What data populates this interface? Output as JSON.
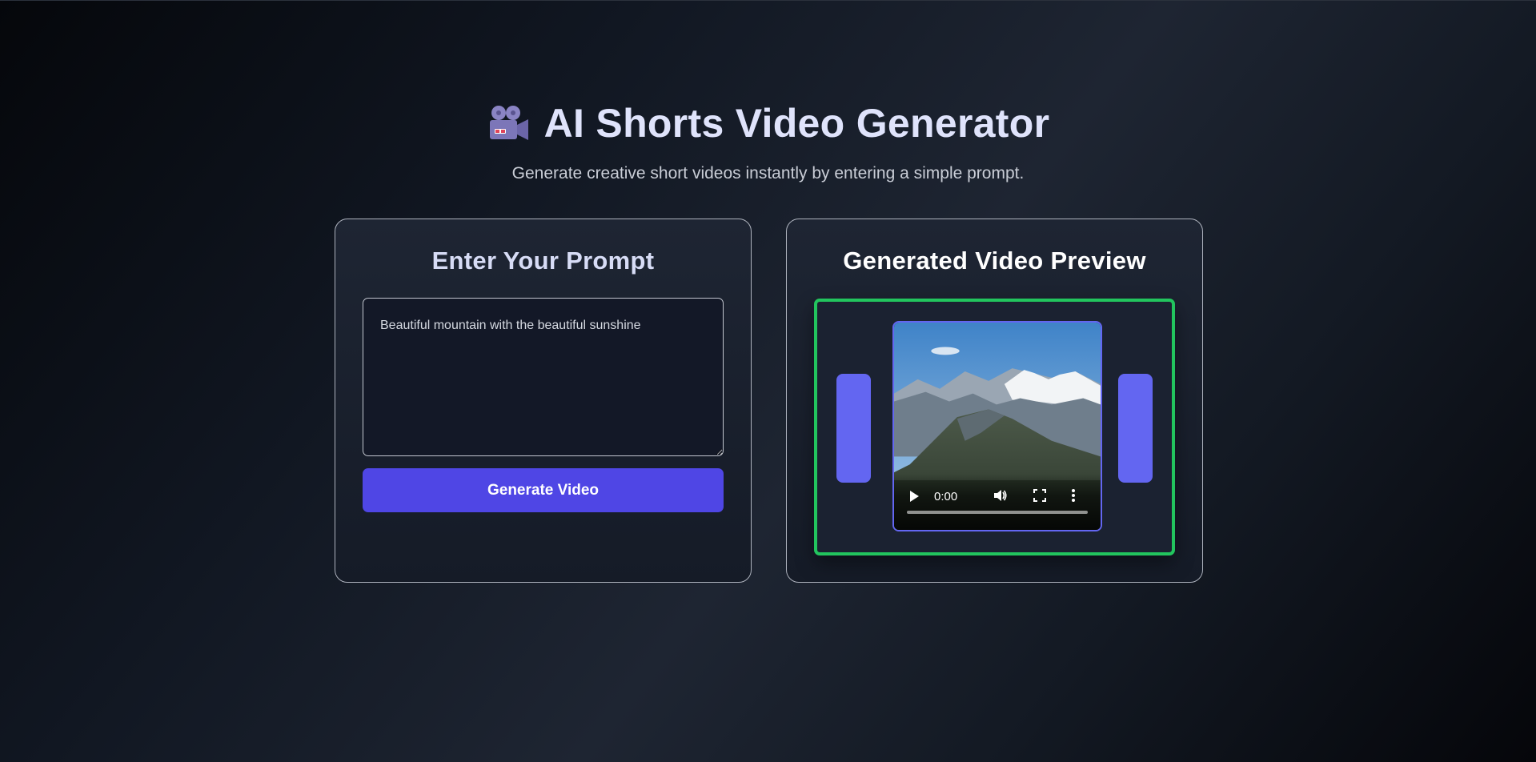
{
  "header": {
    "icon": "movie-camera-icon",
    "title": "AI Shorts Video Generator",
    "subtitle": "Generate creative short videos instantly by entering a simple prompt."
  },
  "prompt_panel": {
    "title": "Enter Your Prompt",
    "prompt_value": "Beautiful mountain with the beautiful sunshine",
    "button_label": "Generate Video"
  },
  "preview_panel": {
    "title": "Generated Video Preview",
    "video": {
      "thumbnail": "mountain-landscape",
      "current_time": "0:00",
      "progress": 0,
      "controls": [
        "play-icon",
        "volume-icon",
        "fullscreen-icon",
        "more-options-icon"
      ]
    }
  },
  "colors": {
    "accent": "#4f46e5",
    "side_bars": "#6366f1",
    "preview_border": "#22c55e",
    "title": "#dfe3fb"
  }
}
